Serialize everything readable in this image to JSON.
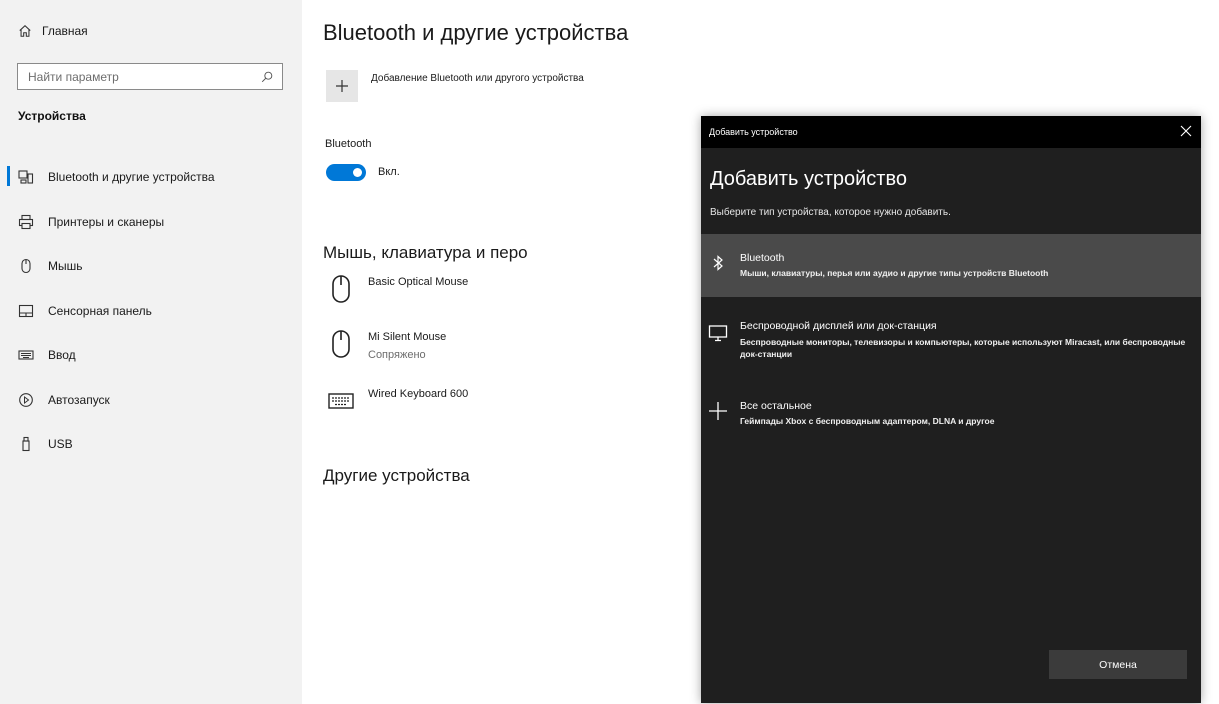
{
  "sidebar": {
    "home_label": "Главная",
    "search_placeholder": "Найти параметр",
    "section_heading": "Устройства",
    "items": [
      {
        "label": "Bluetooth и другие устройства",
        "icon": "bluetooth-devices-icon",
        "active": true
      },
      {
        "label": "Принтеры и сканеры",
        "icon": "printer-icon"
      },
      {
        "label": "Мышь",
        "icon": "mouse-icon"
      },
      {
        "label": "Сенсорная панель",
        "icon": "touchpad-icon"
      },
      {
        "label": "Ввод",
        "icon": "keyboard-icon"
      },
      {
        "label": "Автозапуск",
        "icon": "autoplay-icon"
      },
      {
        "label": "USB",
        "icon": "usb-icon"
      }
    ]
  },
  "main": {
    "title": "Bluetooth и другие устройства",
    "add_device_label": "Добавление Bluetooth или другого устройства",
    "bluetooth_label": "Bluetooth",
    "toggle_state": "Вкл.",
    "accent_color": "#0078d7",
    "mouse_section_heading": "Мышь, клавиатура и перо",
    "devices": [
      {
        "name": "Basic Optical Mouse",
        "status": "",
        "icon": "mouse-icon"
      },
      {
        "name": "Mi Silent Mouse",
        "status": "Сопряжено",
        "icon": "mouse-icon"
      },
      {
        "name": "Wired Keyboard 600",
        "status": "",
        "icon": "keyboard-icon"
      }
    ],
    "other_section_heading": "Другие устройства"
  },
  "dialog": {
    "window_title": "Добавить устройство",
    "heading": "Добавить устройство",
    "subtitle": "Выберите тип устройства, которое нужно добавить.",
    "options": [
      {
        "title": "Bluetooth",
        "description": "Мыши, клавиатуры, перья или аудио и другие типы устройств Bluetooth",
        "icon": "bluetooth-icon",
        "selected": true
      },
      {
        "title": "Беспроводной дисплей или док-станция",
        "description": "Беспроводные мониторы, телевизоры и компьютеры, которые используют Miracast, или беспроводные док-станции",
        "icon": "monitor-icon"
      },
      {
        "title": "Все остальное",
        "description": "Геймпады Xbox с беспроводным адаптером, DLNA и другое",
        "icon": "plus-icon"
      }
    ],
    "cancel_label": "Отмена"
  }
}
